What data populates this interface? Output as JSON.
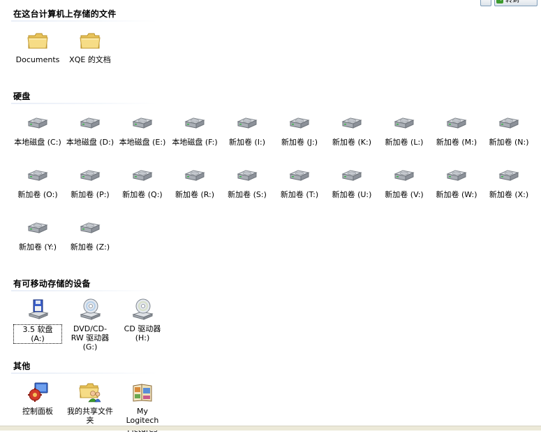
{
  "toolbar": {
    "go_label": "转到"
  },
  "sections": {
    "files": {
      "title": "在这台计算机上存储的文件",
      "items": [
        {
          "label": "Documents",
          "icon": "folder-icon"
        },
        {
          "label": "XQE 的文档",
          "icon": "folder-icon"
        }
      ]
    },
    "disks": {
      "title": "硬盘",
      "items": [
        {
          "label": "本地磁盘 (C:)",
          "icon": "hard-drive-icon"
        },
        {
          "label": "本地磁盘 (D:)",
          "icon": "hard-drive-icon"
        },
        {
          "label": "本地磁盘 (E:)",
          "icon": "hard-drive-icon"
        },
        {
          "label": "本地磁盘 (F:)",
          "icon": "hard-drive-icon"
        },
        {
          "label": "新加卷 (I:)",
          "icon": "hard-drive-icon"
        },
        {
          "label": "新加卷 (J:)",
          "icon": "hard-drive-icon"
        },
        {
          "label": "新加卷 (K:)",
          "icon": "hard-drive-icon"
        },
        {
          "label": "新加卷 (L:)",
          "icon": "hard-drive-icon"
        },
        {
          "label": "新加卷 (M:)",
          "icon": "hard-drive-icon"
        },
        {
          "label": "新加卷 (N:)",
          "icon": "hard-drive-icon"
        },
        {
          "label": "新加卷 (O:)",
          "icon": "hard-drive-icon"
        },
        {
          "label": "新加卷 (P:)",
          "icon": "hard-drive-icon"
        },
        {
          "label": "新加卷 (Q:)",
          "icon": "hard-drive-icon"
        },
        {
          "label": "新加卷 (R:)",
          "icon": "hard-drive-icon"
        },
        {
          "label": "新加卷 (S:)",
          "icon": "hard-drive-icon"
        },
        {
          "label": "新加卷 (T:)",
          "icon": "hard-drive-icon"
        },
        {
          "label": "新加卷 (U:)",
          "icon": "hard-drive-icon"
        },
        {
          "label": "新加卷 (V:)",
          "icon": "hard-drive-icon"
        },
        {
          "label": "新加卷 (W:)",
          "icon": "hard-drive-icon"
        },
        {
          "label": "新加卷 (X:)",
          "icon": "hard-drive-icon"
        },
        {
          "label": "新加卷 (Y:)",
          "icon": "hard-drive-icon"
        },
        {
          "label": "新加卷 (Z:)",
          "icon": "hard-drive-icon"
        }
      ]
    },
    "removable": {
      "title": "有可移动存储的设备",
      "items": [
        {
          "label": "3.5 软盘 (A:)",
          "icon": "floppy-drive-icon"
        },
        {
          "label": "DVD/CD-RW 驱动器 (G:)",
          "icon": "dvd-drive-icon"
        },
        {
          "label": "CD 驱动器 (H:)",
          "icon": "cd-drive-icon"
        }
      ]
    },
    "other": {
      "title": "其他",
      "items": [
        {
          "label": "控制面板",
          "icon": "control-panel-icon"
        },
        {
          "label": "我的共享文件夹",
          "icon": "shared-folder-icon"
        },
        {
          "label": "My Logitech Pictures",
          "icon": "pictures-icon"
        }
      ]
    }
  },
  "colors": {
    "folder": "#f3d774",
    "drive": "#b7bcc2",
    "floppy": "#3a5ec8",
    "disc": "#d9dde3",
    "control_panel": "#d23a2a",
    "section_line": "#e9eef7"
  }
}
